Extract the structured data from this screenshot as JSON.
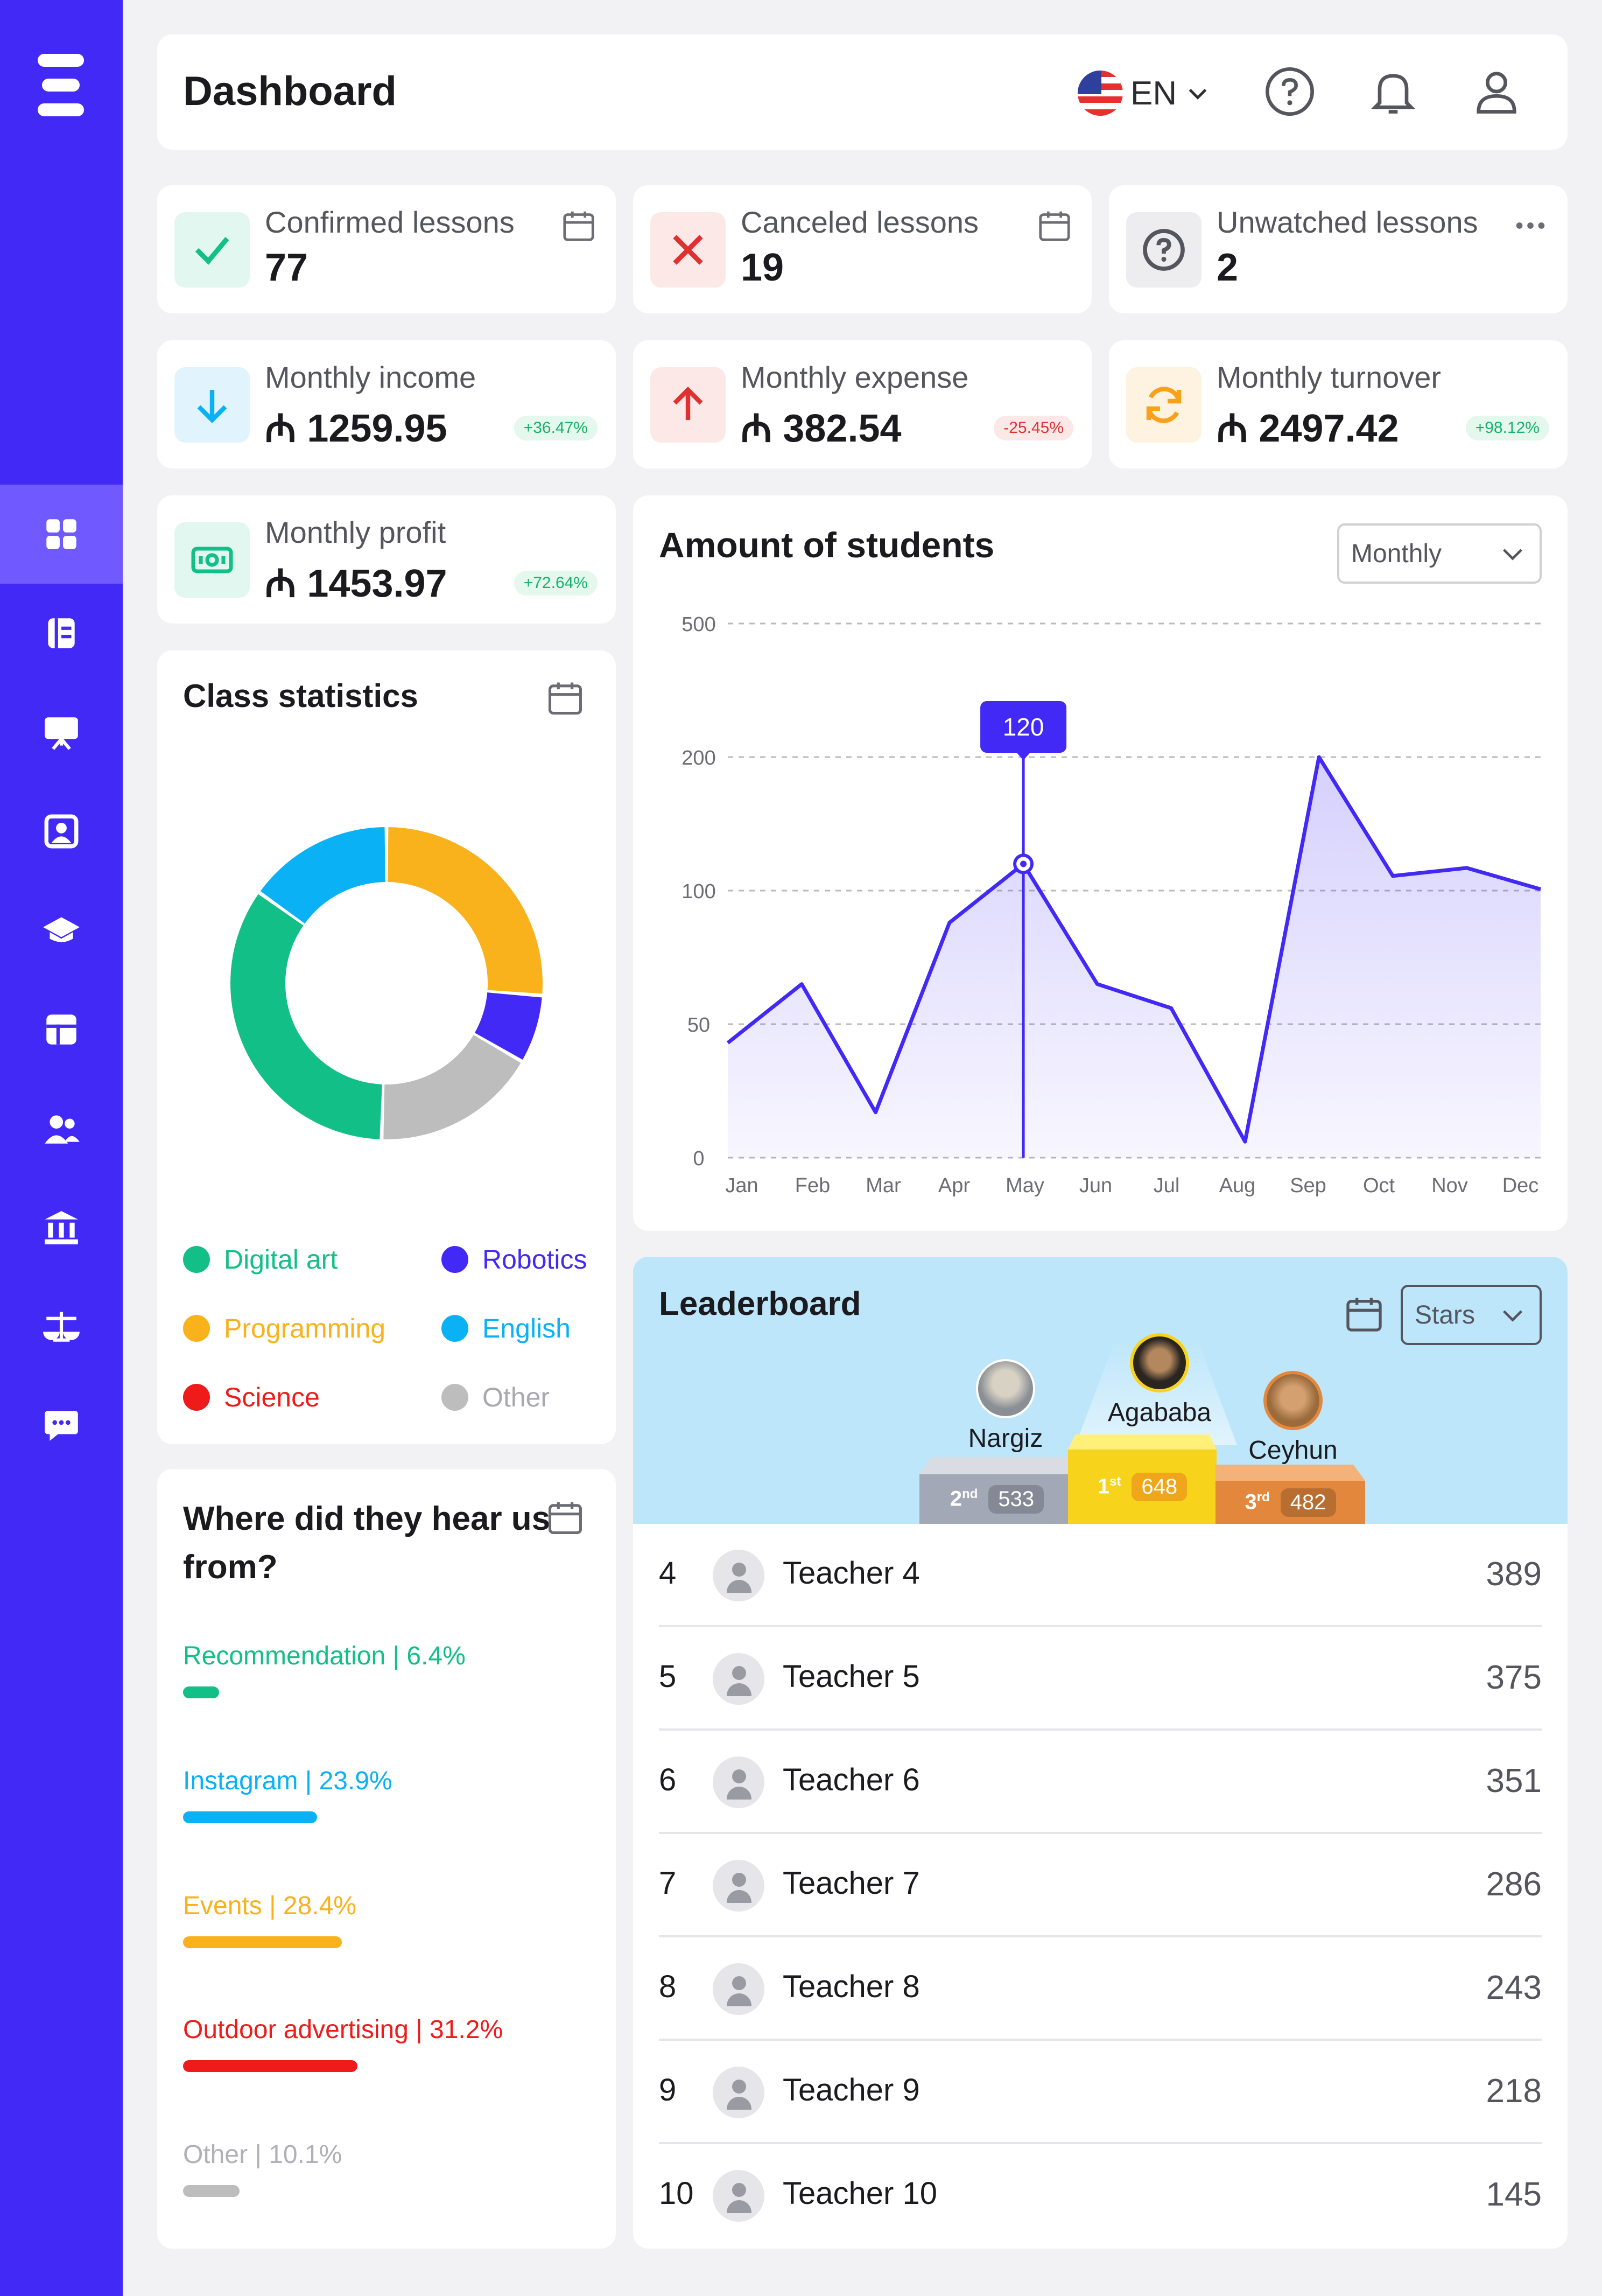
{
  "header": {
    "title": "Dashboard",
    "language": "EN"
  },
  "nav": [
    "dashboard",
    "lessons",
    "presentation",
    "profile",
    "courses",
    "schedule",
    "groups",
    "institution",
    "finance",
    "chat"
  ],
  "stats": [
    {
      "label": "Confirmed lessons",
      "value": "77"
    },
    {
      "label": "Canceled lessons",
      "value": "19"
    },
    {
      "label": "Unwatched lessons",
      "value": "2"
    },
    {
      "label": "Monthly income",
      "value": "₼ 1259.95",
      "change": "+36.47%"
    },
    {
      "label": "Monthly expense",
      "value": "₼ 382.54",
      "change": "-25.45%"
    },
    {
      "label": "Monthly turnover",
      "value": "₼ 2497.42",
      "change": "+98.12%"
    },
    {
      "label": "Monthly profit",
      "value": "₼ 1453.97",
      "change": "+72.64%"
    }
  ],
  "class_stats": {
    "title": "Class statistics",
    "legend": [
      {
        "name": "Digital art",
        "color": "#12bf86",
        "value": 34
      },
      {
        "name": "Robotics",
        "color": "#4229f5",
        "value": 7
      },
      {
        "name": "Programming",
        "color": "#f9b11c",
        "value": 26
      },
      {
        "name": "English",
        "color": "#0ab1f5",
        "value": 15
      },
      {
        "name": "Science",
        "color": "#ef1a1a",
        "value": 0
      },
      {
        "name": "Other",
        "color": "#bdbdbd",
        "value": 17
      }
    ]
  },
  "sources": {
    "title": "Where did they hear us from?",
    "items": [
      {
        "label": "Recommendation | 6.4%",
        "pct": 6.4,
        "color": "#12bf86"
      },
      {
        "label": "Instagram | 23.9%",
        "pct": 23.9,
        "color": "#0ab1f5"
      },
      {
        "label": "Events | 28.4%",
        "pct": 28.4,
        "color": "#f9b11c"
      },
      {
        "label": "Outdoor advertising | 31.2%",
        "pct": 31.2,
        "color": "#ef1a1a"
      },
      {
        "label": "Other | 10.1%",
        "pct": 10.1,
        "color": "#bdbdbd"
      }
    ]
  },
  "chart": {
    "title": "Amount of students",
    "period": "Monthly",
    "tooltip": "120"
  },
  "chart_data": {
    "type": "area",
    "title": "Amount of students",
    "x": [
      "Jan",
      "Feb",
      "Mar",
      "Apr",
      "May",
      "Jun",
      "Jul",
      "Aug",
      "Sep",
      "Oct",
      "Nov",
      "Dec"
    ],
    "y_ticks": [
      "500",
      "200",
      "100",
      "50",
      "0"
    ],
    "series": [
      {
        "values": [
          43,
          65,
          17,
          88,
          120,
          65,
          56,
          6,
          200,
          111,
          117,
          101
        ]
      }
    ],
    "highlight": {
      "x": "May",
      "value": 120
    },
    "color": "#4229f5"
  },
  "leaderboard": {
    "title": "Leaderboard",
    "metric": "Stars",
    "podium": [
      {
        "name": "Nargiz",
        "place": "2",
        "suffix": "nd",
        "score": "533"
      },
      {
        "name": "Agababa",
        "place": "1",
        "suffix": "st",
        "score": "648"
      },
      {
        "name": "Ceyhun",
        "place": "3",
        "suffix": "rd",
        "score": "482"
      }
    ],
    "rows": [
      {
        "rank": "4",
        "name": "Teacher 4",
        "score": "389"
      },
      {
        "rank": "5",
        "name": "Teacher 5",
        "score": "375"
      },
      {
        "rank": "6",
        "name": "Teacher 6",
        "score": "351"
      },
      {
        "rank": "7",
        "name": "Teacher 7",
        "score": "286"
      },
      {
        "rank": "8",
        "name": "Teacher 8",
        "score": "243"
      },
      {
        "rank": "9",
        "name": "Teacher 9",
        "score": "218"
      },
      {
        "rank": "10",
        "name": "Teacher 10",
        "score": "145"
      }
    ]
  }
}
